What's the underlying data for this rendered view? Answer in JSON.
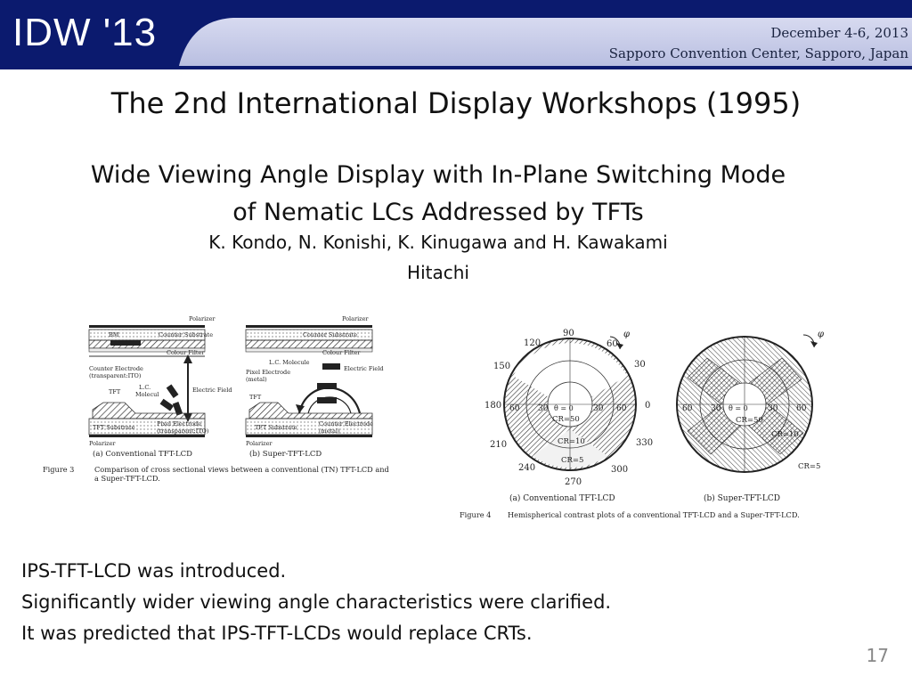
{
  "header": {
    "logo": "IDW '13",
    "dates": "December 4-6, 2013",
    "venue": "Sapporo Convention Center, Sapporo, Japan"
  },
  "title": "The 2nd International Display Workshops (1995)",
  "paper": {
    "title_line1": "Wide Viewing Angle Display with In-Plane Switching Mode",
    "title_line2": "of Nematic LCs Addressed by TFTs",
    "authors": "K. Kondo, N. Konishi, K. Kinugawa and H. Kawakami",
    "affiliation": "Hitachi"
  },
  "figure3": {
    "label_polarizer_top": "Polarizer",
    "label_bm": "BM",
    "label_counter_substrate": "Counter Substrate",
    "label_colour_filter": "Colour Filter",
    "label_counter_electrode": "Counter Electrode",
    "label_counter_electrode_sub": "(transparent:ITO)",
    "label_tft": "TFT",
    "label_lc": "L.C.",
    "label_lc_sub": "Molecul",
    "label_electric_field": "Electric Field",
    "label_tft_substrate": "TFT Substrate",
    "label_pixel_electrode": "Pixel Electrode",
    "label_pixel_electrode_sub": "(transparent:ITO)",
    "label_polarizer_bottom": "Polarizer",
    "b_label_polarizer_top": "Polarizer",
    "b_label_counter_substrate": "Counter Substrate",
    "b_label_colour_filter": "Colour Filter",
    "b_label_lc_molecule": "L.C. Molecule",
    "b_label_electric_field": "Electric Field",
    "b_label_pixel_electrode": "Pixel Electrode",
    "b_label_pixel_electrode_sub": "(metal)",
    "b_label_tft": "TFT",
    "b_label_tft_substrate": "TFT Substrate",
    "b_label_counter_electrode": "Counter Electrode",
    "b_label_counter_electrode_sub": "(metal)",
    "b_label_polarizer_bottom": "Polarizer",
    "caption_a": "(a) Conventional TFT-LCD",
    "caption_b": "(b) Super-TFT-LCD",
    "fig_number": "Figure 3",
    "caption_line1": "Comparison of cross sectional views between  a conventional  (TN) TFT-LCD and",
    "caption_line2": "a Super-TFT-LCD."
  },
  "figure4": {
    "angles": [
      "90",
      "60",
      "30",
      "0",
      "330",
      "300",
      "270",
      "240",
      "210",
      "180",
      "150",
      "120"
    ],
    "phi": "φ",
    "a_radial": [
      "60",
      "30",
      "θ = 0",
      "30",
      "60"
    ],
    "a_cr50": "CR=50",
    "a_cr10": "CR=10",
    "a_cr5": "CR=5",
    "b_radial": [
      "60",
      "30",
      "θ = 0",
      "30",
      "60"
    ],
    "b_cr50": "CR=50",
    "b_cr10": "CR=10",
    "b_cr5": "CR=5",
    "caption_a": "(a) Conventional TFT-LCD",
    "caption_b": "(b) Super-TFT-LCD",
    "fig_number": "Figure 4",
    "caption": "Hemispherical contrast plots of a conventional TFT-LCD and a  Super-TFT-LCD."
  },
  "bullets": [
    "IPS-TFT-LCD was introduced.",
    "Significantly wider viewing angle characteristics were clarified.",
    "It was predicted that IPS-TFT-LCDs would replace CRTs."
  ],
  "page_number": "17",
  "colors": {
    "header_dark": "#0b1a6e",
    "header_light": "#c6cbe8",
    "text": "#111111"
  }
}
